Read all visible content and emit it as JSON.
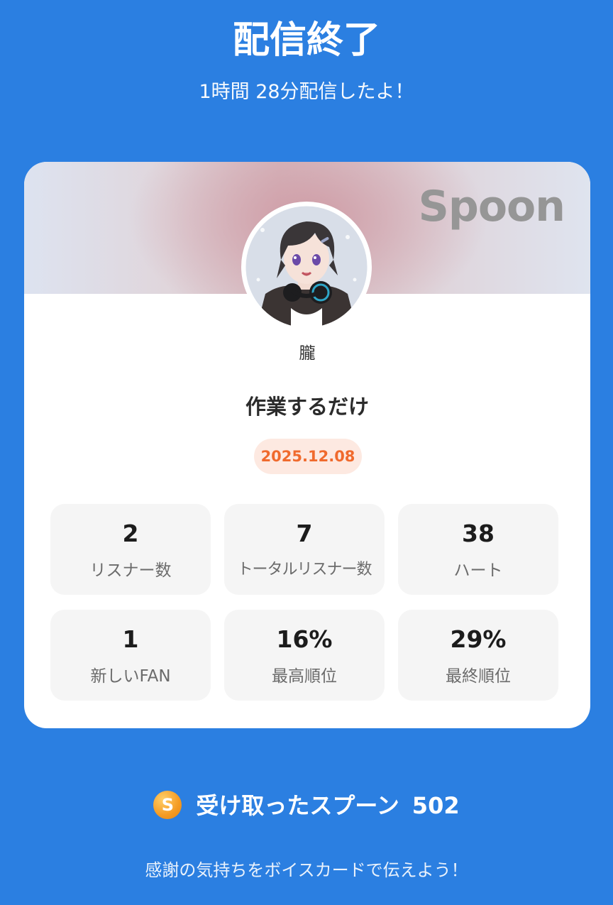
{
  "header": {
    "title": "配信終了",
    "subtitle": "1時間 28分配信したよ！"
  },
  "card": {
    "brand_logo": "Spoon",
    "username": "朧",
    "live_title": "作業するだけ",
    "date": "2025.12.08",
    "stats": [
      {
        "value": "2",
        "label": "リスナー数"
      },
      {
        "value": "7",
        "label": "トータルリスナー数"
      },
      {
        "value": "38",
        "label": "ハート"
      },
      {
        "value": "1",
        "label": "新しいFAN"
      },
      {
        "value": "16%",
        "label": "最高順位"
      },
      {
        "value": "29%",
        "label": "最終順位"
      }
    ]
  },
  "spoons": {
    "icon_letter": "S",
    "label": "受け取ったスプーン",
    "count": "502"
  },
  "footer": {
    "text": "感謝の気持ちをボイスカードで伝えよう！"
  },
  "colors": {
    "background": "#2b7fe1",
    "date_badge_text": "#f06a2d",
    "date_badge_bg": "#fde9e1",
    "spoon_icon": "#f49a22"
  }
}
